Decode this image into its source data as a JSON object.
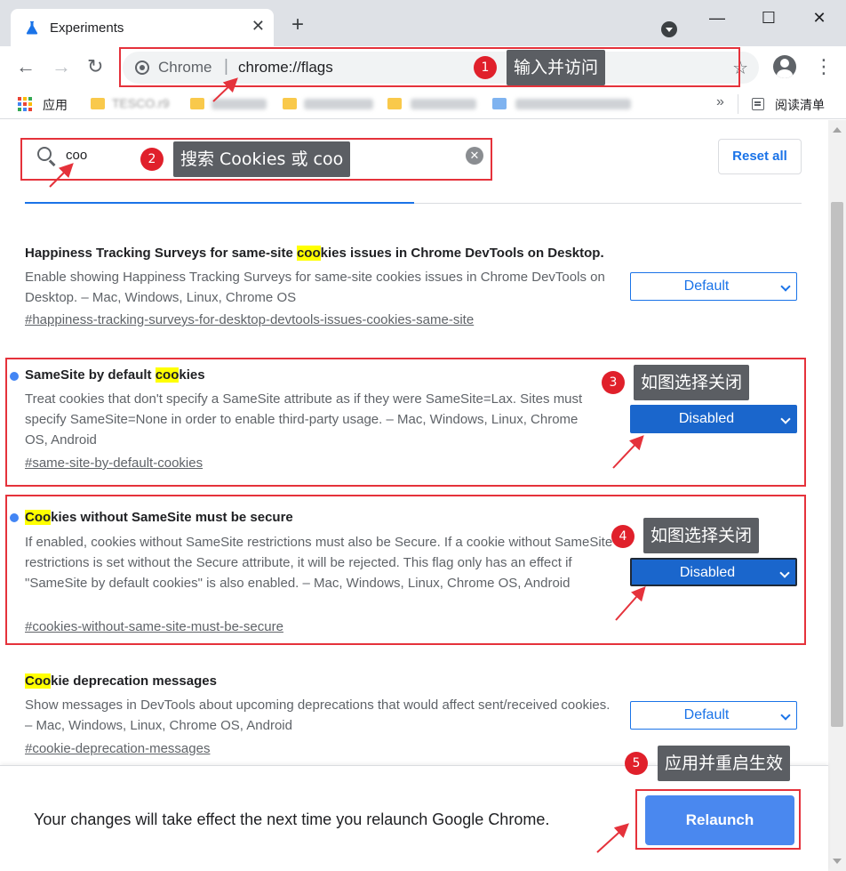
{
  "browser": {
    "tab_title": "Experiments",
    "tab_close": "✕",
    "new_tab": "+",
    "window_minimize": "—",
    "window_maximize": "☐",
    "window_close": "✕",
    "back": "←",
    "forward": "→",
    "reload": "↻",
    "omnibox_site": "Chrome",
    "omnibox_sep": "|",
    "omnibox_url": "chrome://flags",
    "bookmark_star": "☆",
    "menu": "⋮"
  },
  "bookmarks": {
    "apps_label": "应用",
    "item1_label": "TESCO.r9",
    "more": "»",
    "reading_list": "阅读清单"
  },
  "flags": {
    "search_value": "coo",
    "search_clear": "✕",
    "reset_all": "Reset all",
    "experiments": [
      {
        "title_pre": "Happiness Tracking Surveys for same-site ",
        "title_mark": "coo",
        "title_post": "kies issues in Chrome DevTools on Desktop.",
        "description": "Enable showing Happiness Tracking Surveys for same-site cookies issues in Chrome DevTools on Desktop. – Mac, Windows, Linux, Chrome OS",
        "link": "#happiness-tracking-surveys-for-desktop-devtools-issues-cookies-same-site",
        "selected": "Default"
      },
      {
        "title_pre": "SameSite by default ",
        "title_mark": "coo",
        "title_post": "kies",
        "description": "Treat cookies that don't specify a SameSite attribute as if they were SameSite=Lax. Sites must specify SameSite=None in order to enable third-party usage. – Mac, Windows, Linux, Chrome OS, Android",
        "link": "#same-site-by-default-cookies",
        "selected": "Disabled"
      },
      {
        "title_pre": "",
        "title_mark": "Coo",
        "title_post": "kies without SameSite must be secure",
        "description": "If enabled, cookies without SameSite restrictions must also be Secure. If a cookie without SameSite restrictions is set without the Secure attribute, it will be rejected. This flag only has an effect if \"SameSite by default cookies\" is also enabled. – Mac, Windows, Linux, Chrome OS, Android",
        "link": "#cookies-without-same-site-must-be-secure",
        "selected": "Disabled"
      },
      {
        "title_pre": "",
        "title_mark": "Coo",
        "title_post": "kie deprecation messages",
        "description": "Show messages in DevTools about upcoming deprecations that would affect sent/received cookies. – Mac, Windows, Linux, Chrome OS, Android",
        "link": "#cookie-deprecation-messages",
        "selected": "Default"
      }
    ]
  },
  "relaunch": {
    "message": "Your changes will take effect the next time you relaunch Google Chrome.",
    "button": "Relaunch"
  },
  "annotations": [
    {
      "num": "1",
      "label": "输入并访问"
    },
    {
      "num": "2",
      "label": "搜索 Cookies 或 coo"
    },
    {
      "num": "3",
      "label": "如图选择关闭"
    },
    {
      "num": "4",
      "label": "如图选择关闭"
    },
    {
      "num": "5",
      "label": "应用并重启生效"
    }
  ],
  "colors": {
    "accent": "#1a73e8",
    "highlight": "#ffff00",
    "annotation_red": "#e5323b",
    "annotation_label_bg": "#5b5e63"
  }
}
